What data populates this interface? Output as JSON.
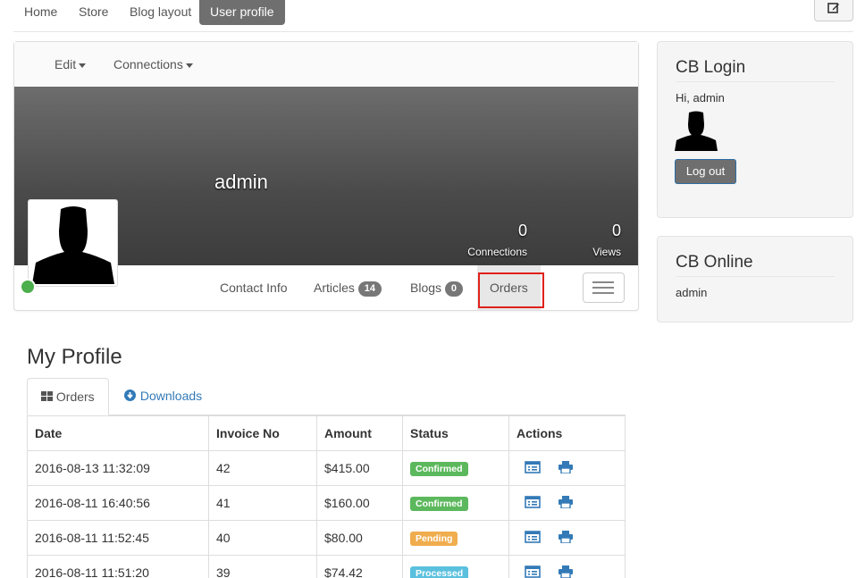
{
  "topnav": {
    "items": [
      {
        "label": "Home"
      },
      {
        "label": "Store"
      },
      {
        "label": "Blog layout"
      },
      {
        "label": "User profile"
      }
    ]
  },
  "profile": {
    "menu": {
      "edit": "Edit",
      "connections": "Connections"
    },
    "username": "admin",
    "stats": {
      "connections": {
        "value": "0",
        "label": "Connections"
      },
      "views": {
        "value": "0",
        "label": "Views"
      }
    },
    "tabs": {
      "contact": "Contact Info",
      "articles": "Articles",
      "articles_count": "14",
      "blogs": "Blogs",
      "blogs_count": "0",
      "orders": "Orders"
    }
  },
  "my_profile": {
    "title": "My Profile",
    "tabs": {
      "orders": "Orders",
      "downloads": "Downloads"
    },
    "table": {
      "headers": {
        "date": "Date",
        "invoice": "Invoice No",
        "amount": "Amount",
        "status": "Status",
        "actions": "Actions"
      },
      "rows": [
        {
          "date": "2016-08-13 11:32:09",
          "invoice": "42",
          "amount": "$415.00",
          "status": "Confirmed",
          "status_color": "#5cb85c"
        },
        {
          "date": "2016-08-11 16:40:56",
          "invoice": "41",
          "amount": "$160.00",
          "status": "Confirmed",
          "status_color": "#5cb85c"
        },
        {
          "date": "2016-08-11 11:52:45",
          "invoice": "40",
          "amount": "$80.00",
          "status": "Pending",
          "status_color": "#f0ad4e"
        },
        {
          "date": "2016-08-11 11:51:20",
          "invoice": "39",
          "amount": "$74.42",
          "status": "Processed",
          "status_color": "#5bc0de"
        }
      ]
    }
  },
  "sidebar": {
    "login": {
      "title": "CB Login",
      "greeting": "Hi, admin",
      "logout": "Log out"
    },
    "online": {
      "title": "CB Online",
      "user": "admin"
    }
  },
  "colors": {
    "accent": "#337ab7",
    "active_nav": "#6f6f6f",
    "online": "#4cae4c",
    "highlight": "#e0211c"
  },
  "icons": [
    "edit-icon",
    "caret-down-icon",
    "avatar-silhouette-icon",
    "hamburger-icon",
    "grid-icon",
    "cloud-download-icon",
    "invoice-view-icon",
    "print-icon"
  ]
}
